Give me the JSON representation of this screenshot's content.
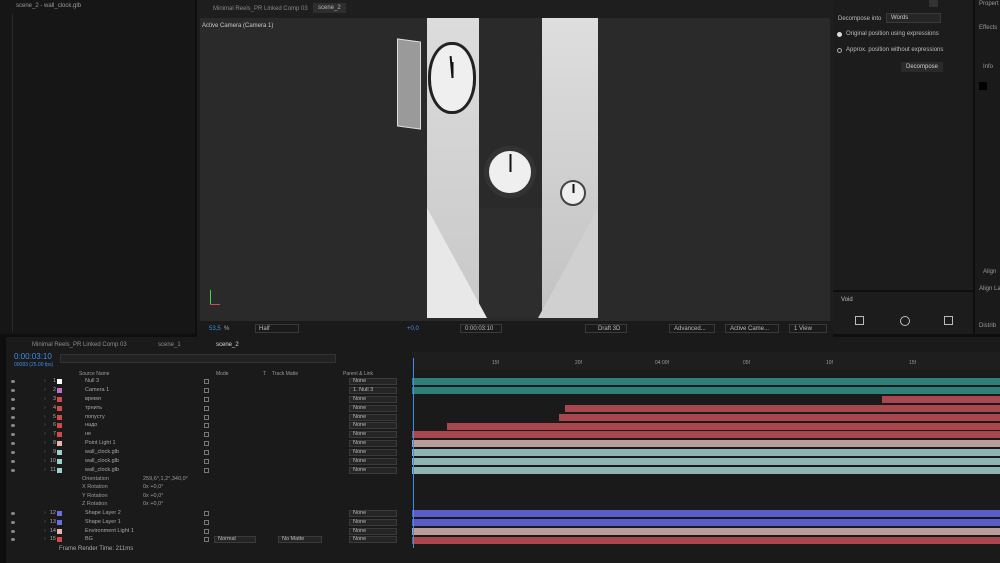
{
  "project": {
    "title": "scene_2 - wall_clock.glb"
  },
  "viewer": {
    "tabs": [
      "Minimal Reels_PR Linked Comp 03",
      "scene_2"
    ],
    "camera_label": "Active Camera (Camera 1)",
    "zoom": "53,5",
    "zoom_unit": "%",
    "resolution": "Half",
    "exposure": "+0,0",
    "timecode": "0:00:03:10",
    "renderer": "Draft 3D",
    "renderer_mode": "Advanced...",
    "camera_view": "Active Came...",
    "views": "1 View"
  },
  "properties": {
    "decompose_label": "Decompose into",
    "decompose_value": "Words",
    "option1": "Original position using expressions",
    "option2": "Approx. position without expressions",
    "decompose_button": "Decompose",
    "void_label": "Void"
  },
  "right_panel": {
    "properties": "Propert",
    "effects": "Effects",
    "info": "Info",
    "align": "Align",
    "align_layers": "Align La",
    "distribute": "Distrib"
  },
  "timeline": {
    "tabs": [
      "Minimal Reels_PR Linked Comp 03",
      "scene_1",
      "scene_2"
    ],
    "timecode": "0:00:03:10",
    "frame_info": "00083 (25.00 fps)",
    "headers": {
      "name": "Source Name",
      "mode": "Mode",
      "t": "T",
      "matte": "Track Matte",
      "parent": "Parent & Link"
    },
    "ruler": [
      "15f",
      "20f",
      "04:00f",
      "05f",
      "10f",
      "15f"
    ],
    "layers": [
      {
        "num": "1",
        "name": "Null 3",
        "color": "#ffffff",
        "parent": "None"
      },
      {
        "num": "2",
        "name": "Camera 1",
        "color": "#c26ec2",
        "parent": "1. Null 3"
      },
      {
        "num": "3",
        "name": "время",
        "color": "#d14a4a",
        "parent": "None"
      },
      {
        "num": "4",
        "name": "трнить",
        "color": "#d14a4a",
        "parent": "None"
      },
      {
        "num": "5",
        "name": "попусту",
        "color": "#d14a4a",
        "parent": "None"
      },
      {
        "num": "6",
        "name": "надо",
        "color": "#d14a4a",
        "parent": "None"
      },
      {
        "num": "7",
        "name": "не",
        "color": "#d14a4a",
        "parent": "None"
      },
      {
        "num": "8",
        "name": "Point Light 1",
        "color": "#e8b8b0",
        "parent": "None"
      },
      {
        "num": "9",
        "name": "wall_clock.glb",
        "color": "#9ecfcf",
        "parent": "None"
      },
      {
        "num": "10",
        "name": "wall_clock.glb",
        "color": "#9ecfcf",
        "parent": "None"
      },
      {
        "num": "11",
        "name": "wall_clock.glb",
        "color": "#9ecfcf",
        "parent": "None"
      }
    ],
    "props": [
      {
        "name": "Orientation",
        "value": "259,6°,1,2°,340,0°"
      },
      {
        "name": "X Rotation",
        "value": "0x +0,0°"
      },
      {
        "name": "Y Rotation",
        "value": "0x +0,0°"
      },
      {
        "name": "Z Rotation",
        "value": "0x +0,0°"
      }
    ],
    "layers2": [
      {
        "num": "12",
        "name": "Shape Layer 2",
        "color": "#6b6ee0",
        "parent": "None"
      },
      {
        "num": "13",
        "name": "Shape Layer 1",
        "color": "#6b6ee0",
        "parent": "None"
      },
      {
        "num": "14",
        "name": "Environment Light 1",
        "color": "#e8b8b0",
        "parent": "None"
      },
      {
        "num": "15",
        "name": "BG",
        "color": "#d14a4a",
        "parent": "None",
        "mode": "Normal",
        "matte": "No Matte"
      }
    ],
    "render_time": "Frame Render Time: 211ms"
  }
}
